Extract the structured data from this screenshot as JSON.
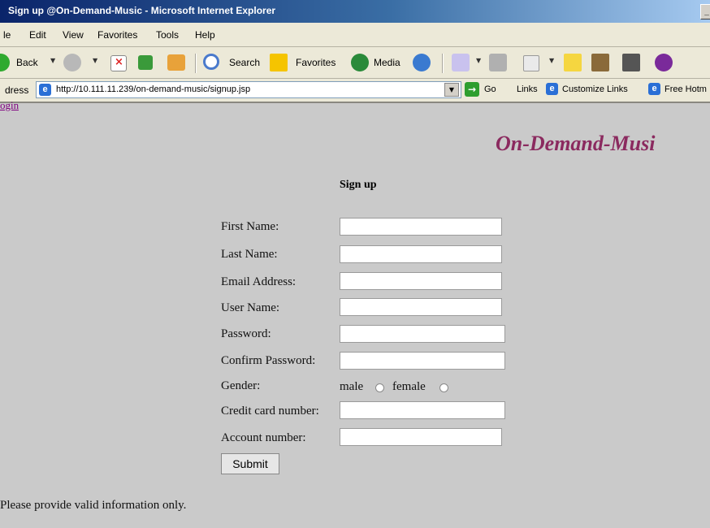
{
  "window": {
    "title": "Sign up @On-Demand-Music - Microsoft Internet Explorer"
  },
  "menu": {
    "items": [
      "le",
      "Edit",
      "View",
      "Favorites",
      "Tools",
      "Help"
    ]
  },
  "toolbar": {
    "back": "Back",
    "search": "Search",
    "favorites": "Favorites",
    "media": "Media"
  },
  "address": {
    "label": "dress",
    "url": "http://10.111.11.239/on-demand-music/signup.jsp",
    "go": "Go",
    "links_label": "Links",
    "links": [
      "Customize Links",
      "Free Hotm"
    ]
  },
  "page": {
    "login_link": "ogin",
    "site_title": "On-Demand-Musi",
    "heading": "Sign up",
    "fields": [
      {
        "label": "First Name:"
      },
      {
        "label": "Last Name:"
      },
      {
        "label": "Email Address:"
      },
      {
        "label": "User Name:"
      },
      {
        "label": "Password:"
      },
      {
        "label": "Confirm Password:"
      },
      {
        "label": "Gender:"
      },
      {
        "label": "Credit card number:"
      },
      {
        "label": "Account number:"
      }
    ],
    "gender_options": [
      "male",
      "female"
    ],
    "submit": "Submit",
    "notice": "Please provide valid information only."
  },
  "colors": {
    "page_bg": "#cacaca",
    "title_bar": "#0a246a",
    "site_title": "#8b2a5f",
    "link": "#800080"
  }
}
